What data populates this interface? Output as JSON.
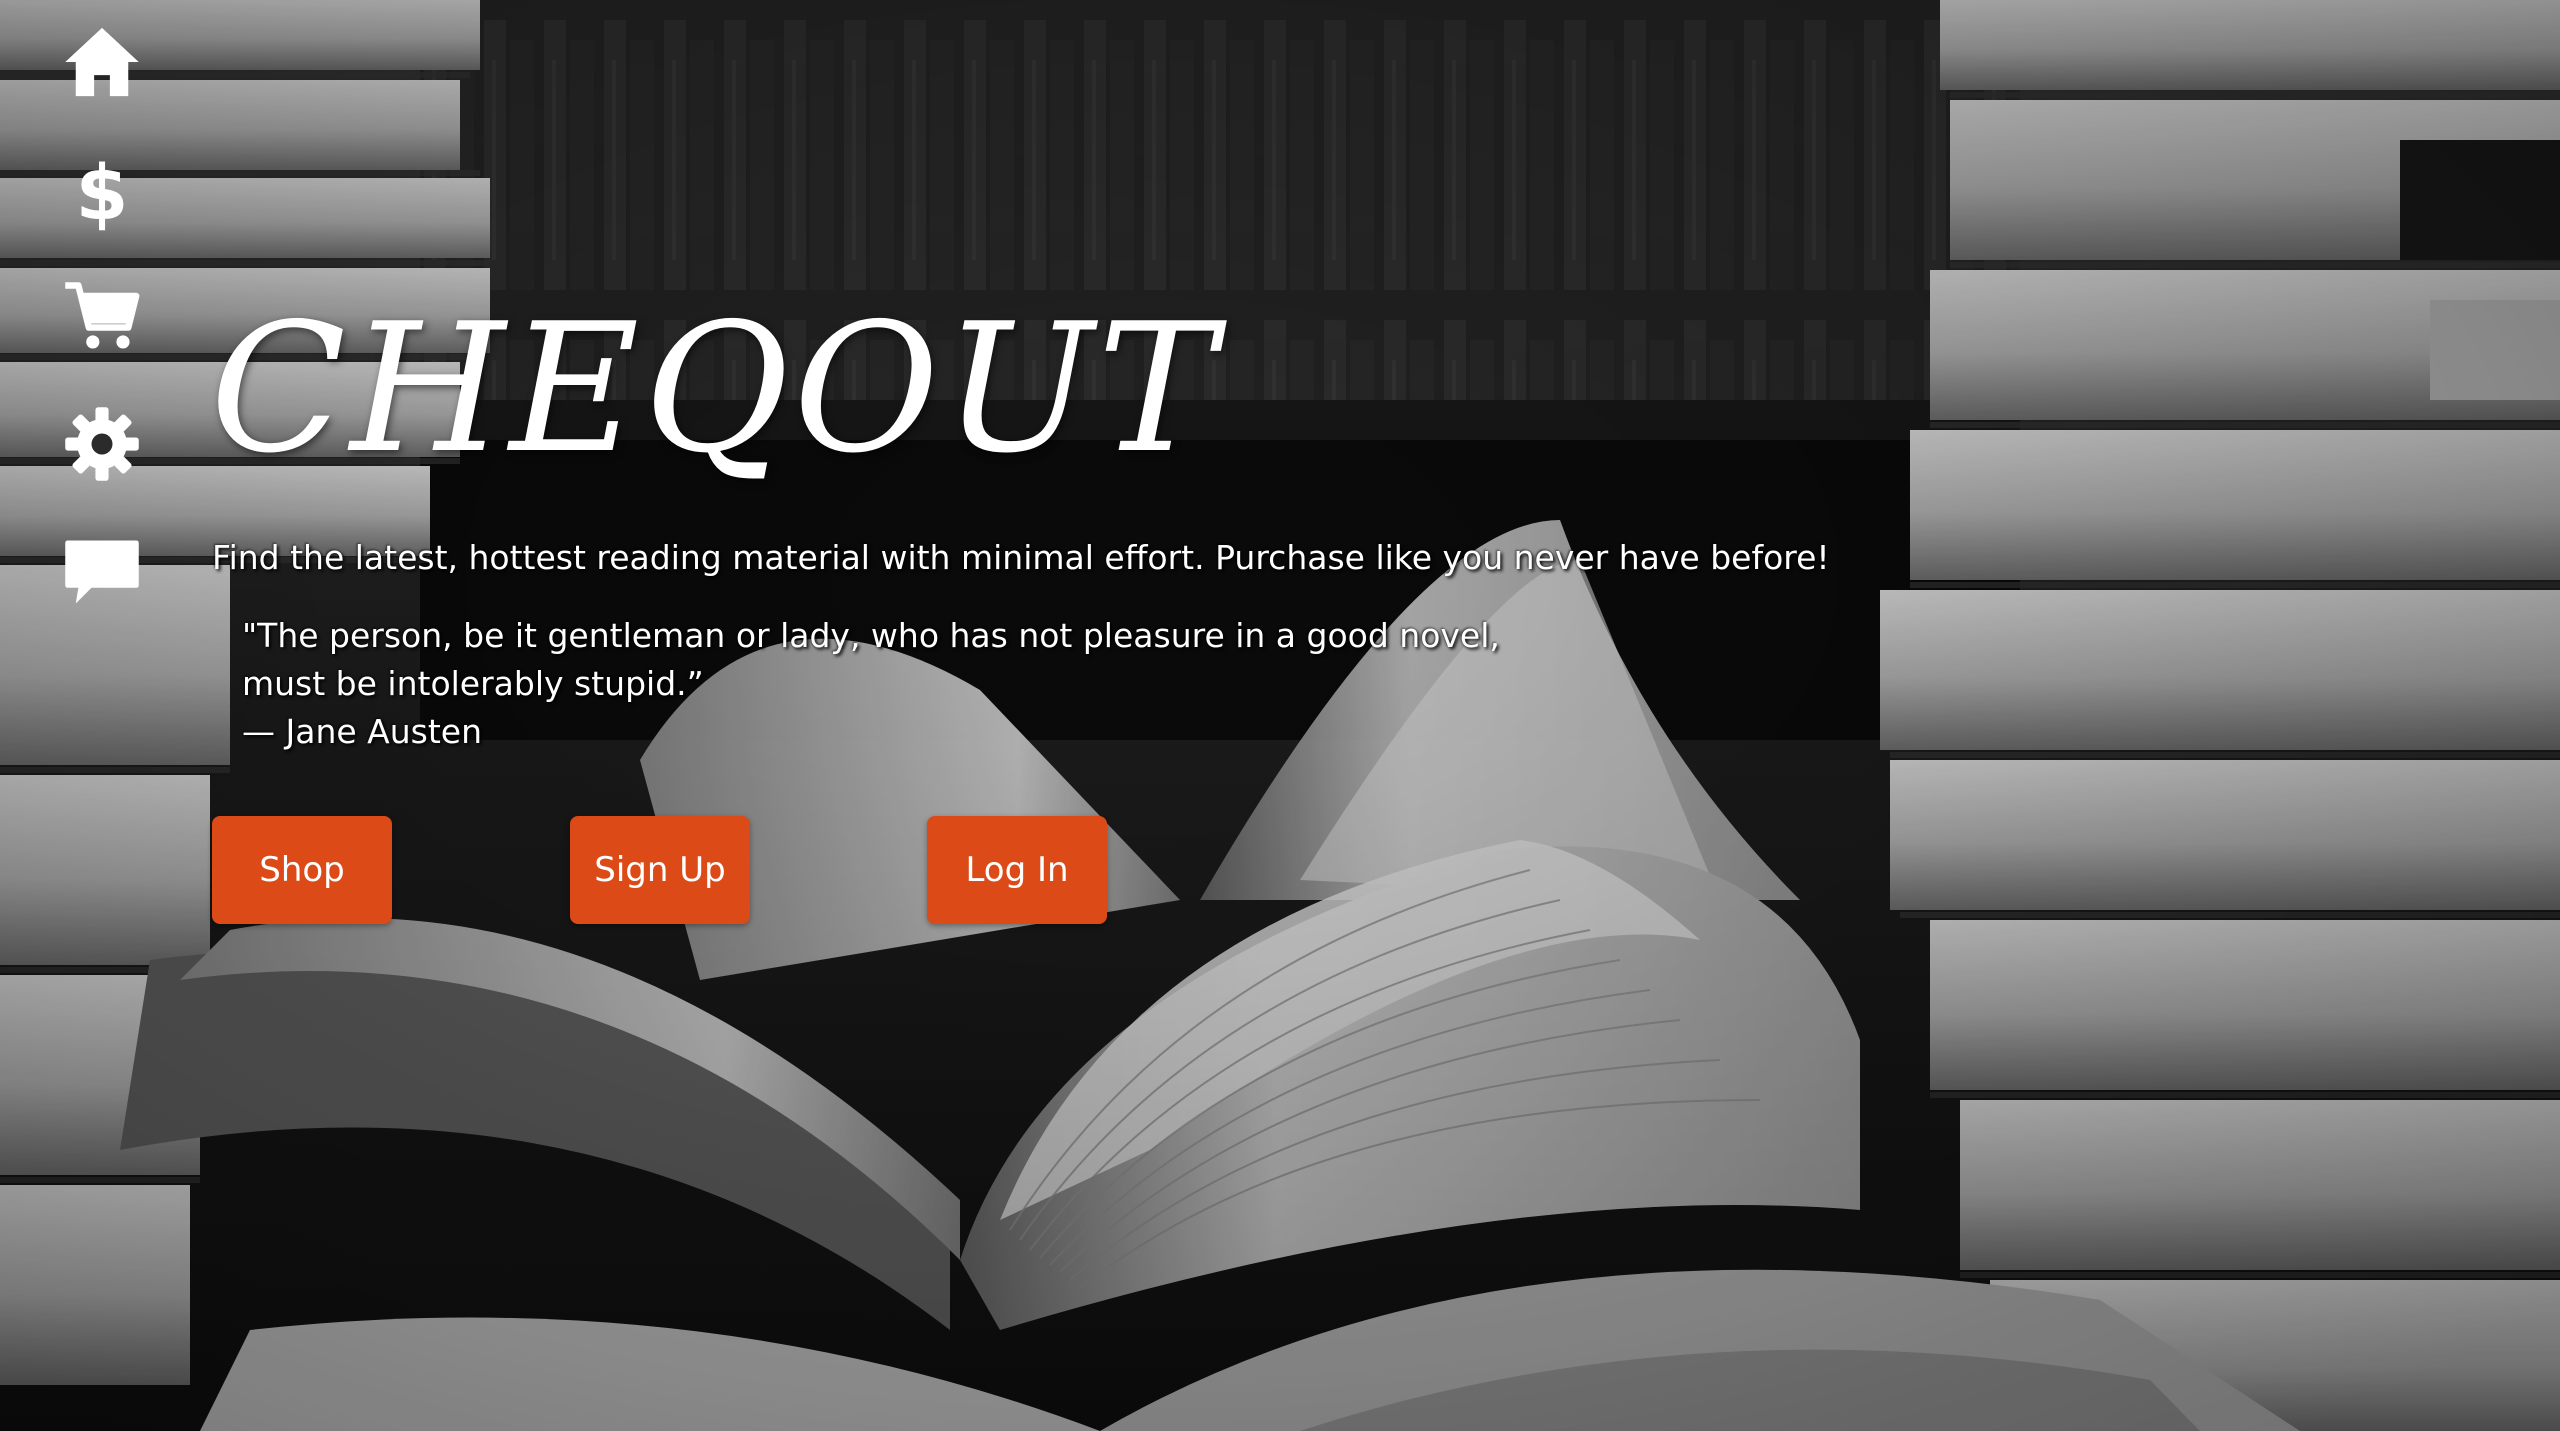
{
  "nav": {
    "items": [
      {
        "icon": "home-icon",
        "label": "Home"
      },
      {
        "icon": "dollar-icon",
        "label": "Pricing"
      },
      {
        "icon": "cart-icon",
        "label": "Cart"
      },
      {
        "icon": "gear-icon",
        "label": "Settings"
      },
      {
        "icon": "chat-icon",
        "label": "Messages"
      }
    ]
  },
  "hero": {
    "brand": "CHEQOUT",
    "tagline": "Find the latest, hottest reading material with minimal effort. Purchase like you never have before!",
    "quote_line1": "\"The person, be it gentleman or lady, who has not pleasure in a good novel,",
    "quote_line2": "must be intolerably stupid.”",
    "quote_author": "— Jane Austen"
  },
  "actions": {
    "shop_label": "Shop",
    "signup_label": "Sign Up",
    "login_label": "Log In"
  },
  "colors": {
    "accent": "#dc4a17",
    "text": "#ffffff"
  }
}
